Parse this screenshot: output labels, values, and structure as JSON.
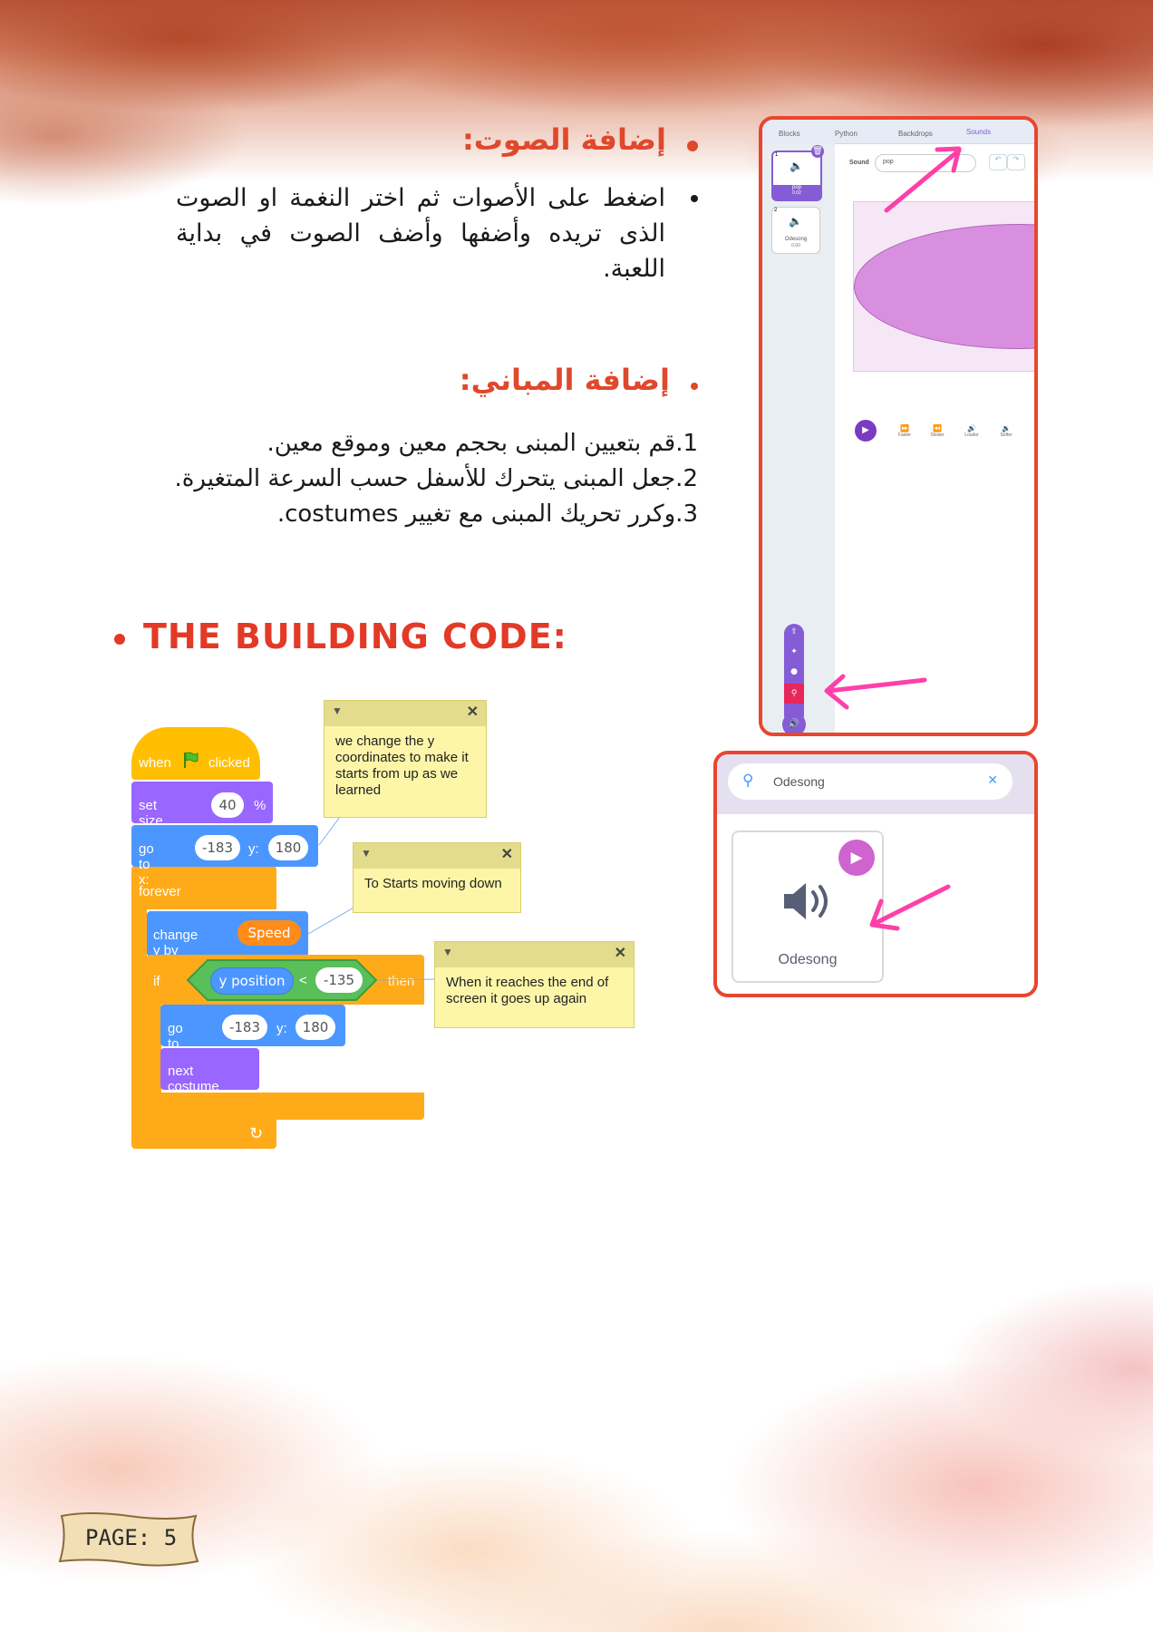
{
  "sections": {
    "sound": {
      "heading": "إضافة الصوت:",
      "text": "اضغط على الأصوات ثم اختر النغمة او الصوت الذى تريده وأضفها وأضف الصوت في بداية اللعبة."
    },
    "buildings": {
      "heading": "إضافة المباني:",
      "steps": [
        "1.قم بتعيين المبنى بحجم معين وموقع معين.",
        "2.جعل المبنى يتحرك للأسفل حسب السرعة المتغيرة.",
        "3.وكرر تحريك المبنى مع تغيير costumes."
      ]
    }
  },
  "code_title": "THE BUILDING CODE:",
  "blocks": {
    "when_label": "when",
    "clicked_label": "clicked",
    "set_size_label": "set size to",
    "set_size_value": "40",
    "percent": "%",
    "goto_label": "go to x:",
    "goto_x": "-183",
    "y_label": "y:",
    "goto_y": "180",
    "forever_label": "forever",
    "change_y_label": "change y by",
    "speed_var": "Speed",
    "if_label": "if",
    "y_position": "y position",
    "less_than": "<",
    "compare_value": "-135",
    "then_label": "then",
    "goto2_x": "-183",
    "goto2_y": "180",
    "next_costume": "next costume"
  },
  "notes": [
    "we change the y coordinates to make it starts from up as we learned",
    "To Starts moving down",
    "When it reaches the end of screen it goes up again"
  ],
  "editor": {
    "tabs": [
      "Blocks",
      "Python",
      "Backdrops",
      "Sounds"
    ],
    "sounds": [
      {
        "num": "1",
        "name": "pop",
        "duration": "0.02"
      },
      {
        "num": "2",
        "name": "Odesong",
        "duration": "0.60"
      }
    ],
    "sound_label": "Sound",
    "sound_name_value": "pop",
    "effects": [
      "Faster",
      "Slower",
      "Louder",
      "Softer"
    ]
  },
  "library": {
    "search_value": "Odesong",
    "card_name": "Odesong"
  },
  "footer": {
    "page_label": "PAGE: 5"
  },
  "colors": {
    "accent": "#e0482c",
    "motion": "#4c97ff",
    "looks": "#9966ff",
    "control": "#ffab19",
    "events": "#ffbf00",
    "operators": "#59c059",
    "variables": "#ff8c1a"
  }
}
